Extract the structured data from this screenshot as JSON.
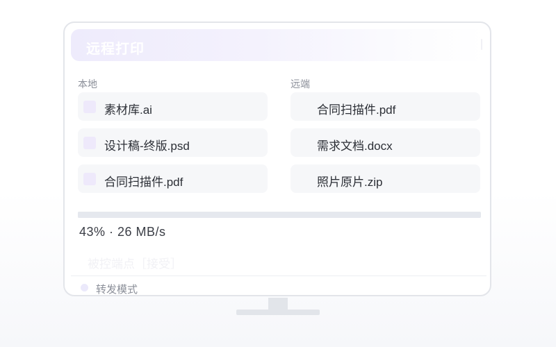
{
  "window": {
    "title": "远程打印"
  },
  "local": {
    "label": "本地",
    "files": [
      {
        "name": "素材库.ai"
      },
      {
        "name": "设计稿-终版.psd"
      },
      {
        "name": "合同扫描件.pdf"
      }
    ]
  },
  "remote": {
    "label": "远端",
    "files": [
      {
        "name": "合同扫描件.pdf"
      },
      {
        "name": "需求文档.docx"
      },
      {
        "name": "照片原片.zip"
      }
    ]
  },
  "transfer": {
    "progress_percent": 43,
    "status_text": "43% · 26 MB/s"
  },
  "controlled_endpoint": {
    "text": "被控端点［接受］"
  },
  "mode": {
    "label": "转发模式"
  },
  "colors": {
    "accent_soft": "#eee9fb",
    "title_gradient_start": "#eeebfc",
    "row_background": "#f6f7f9",
    "progress_track": "#e5e8ee",
    "monitor_border": "#e3e5ea"
  }
}
